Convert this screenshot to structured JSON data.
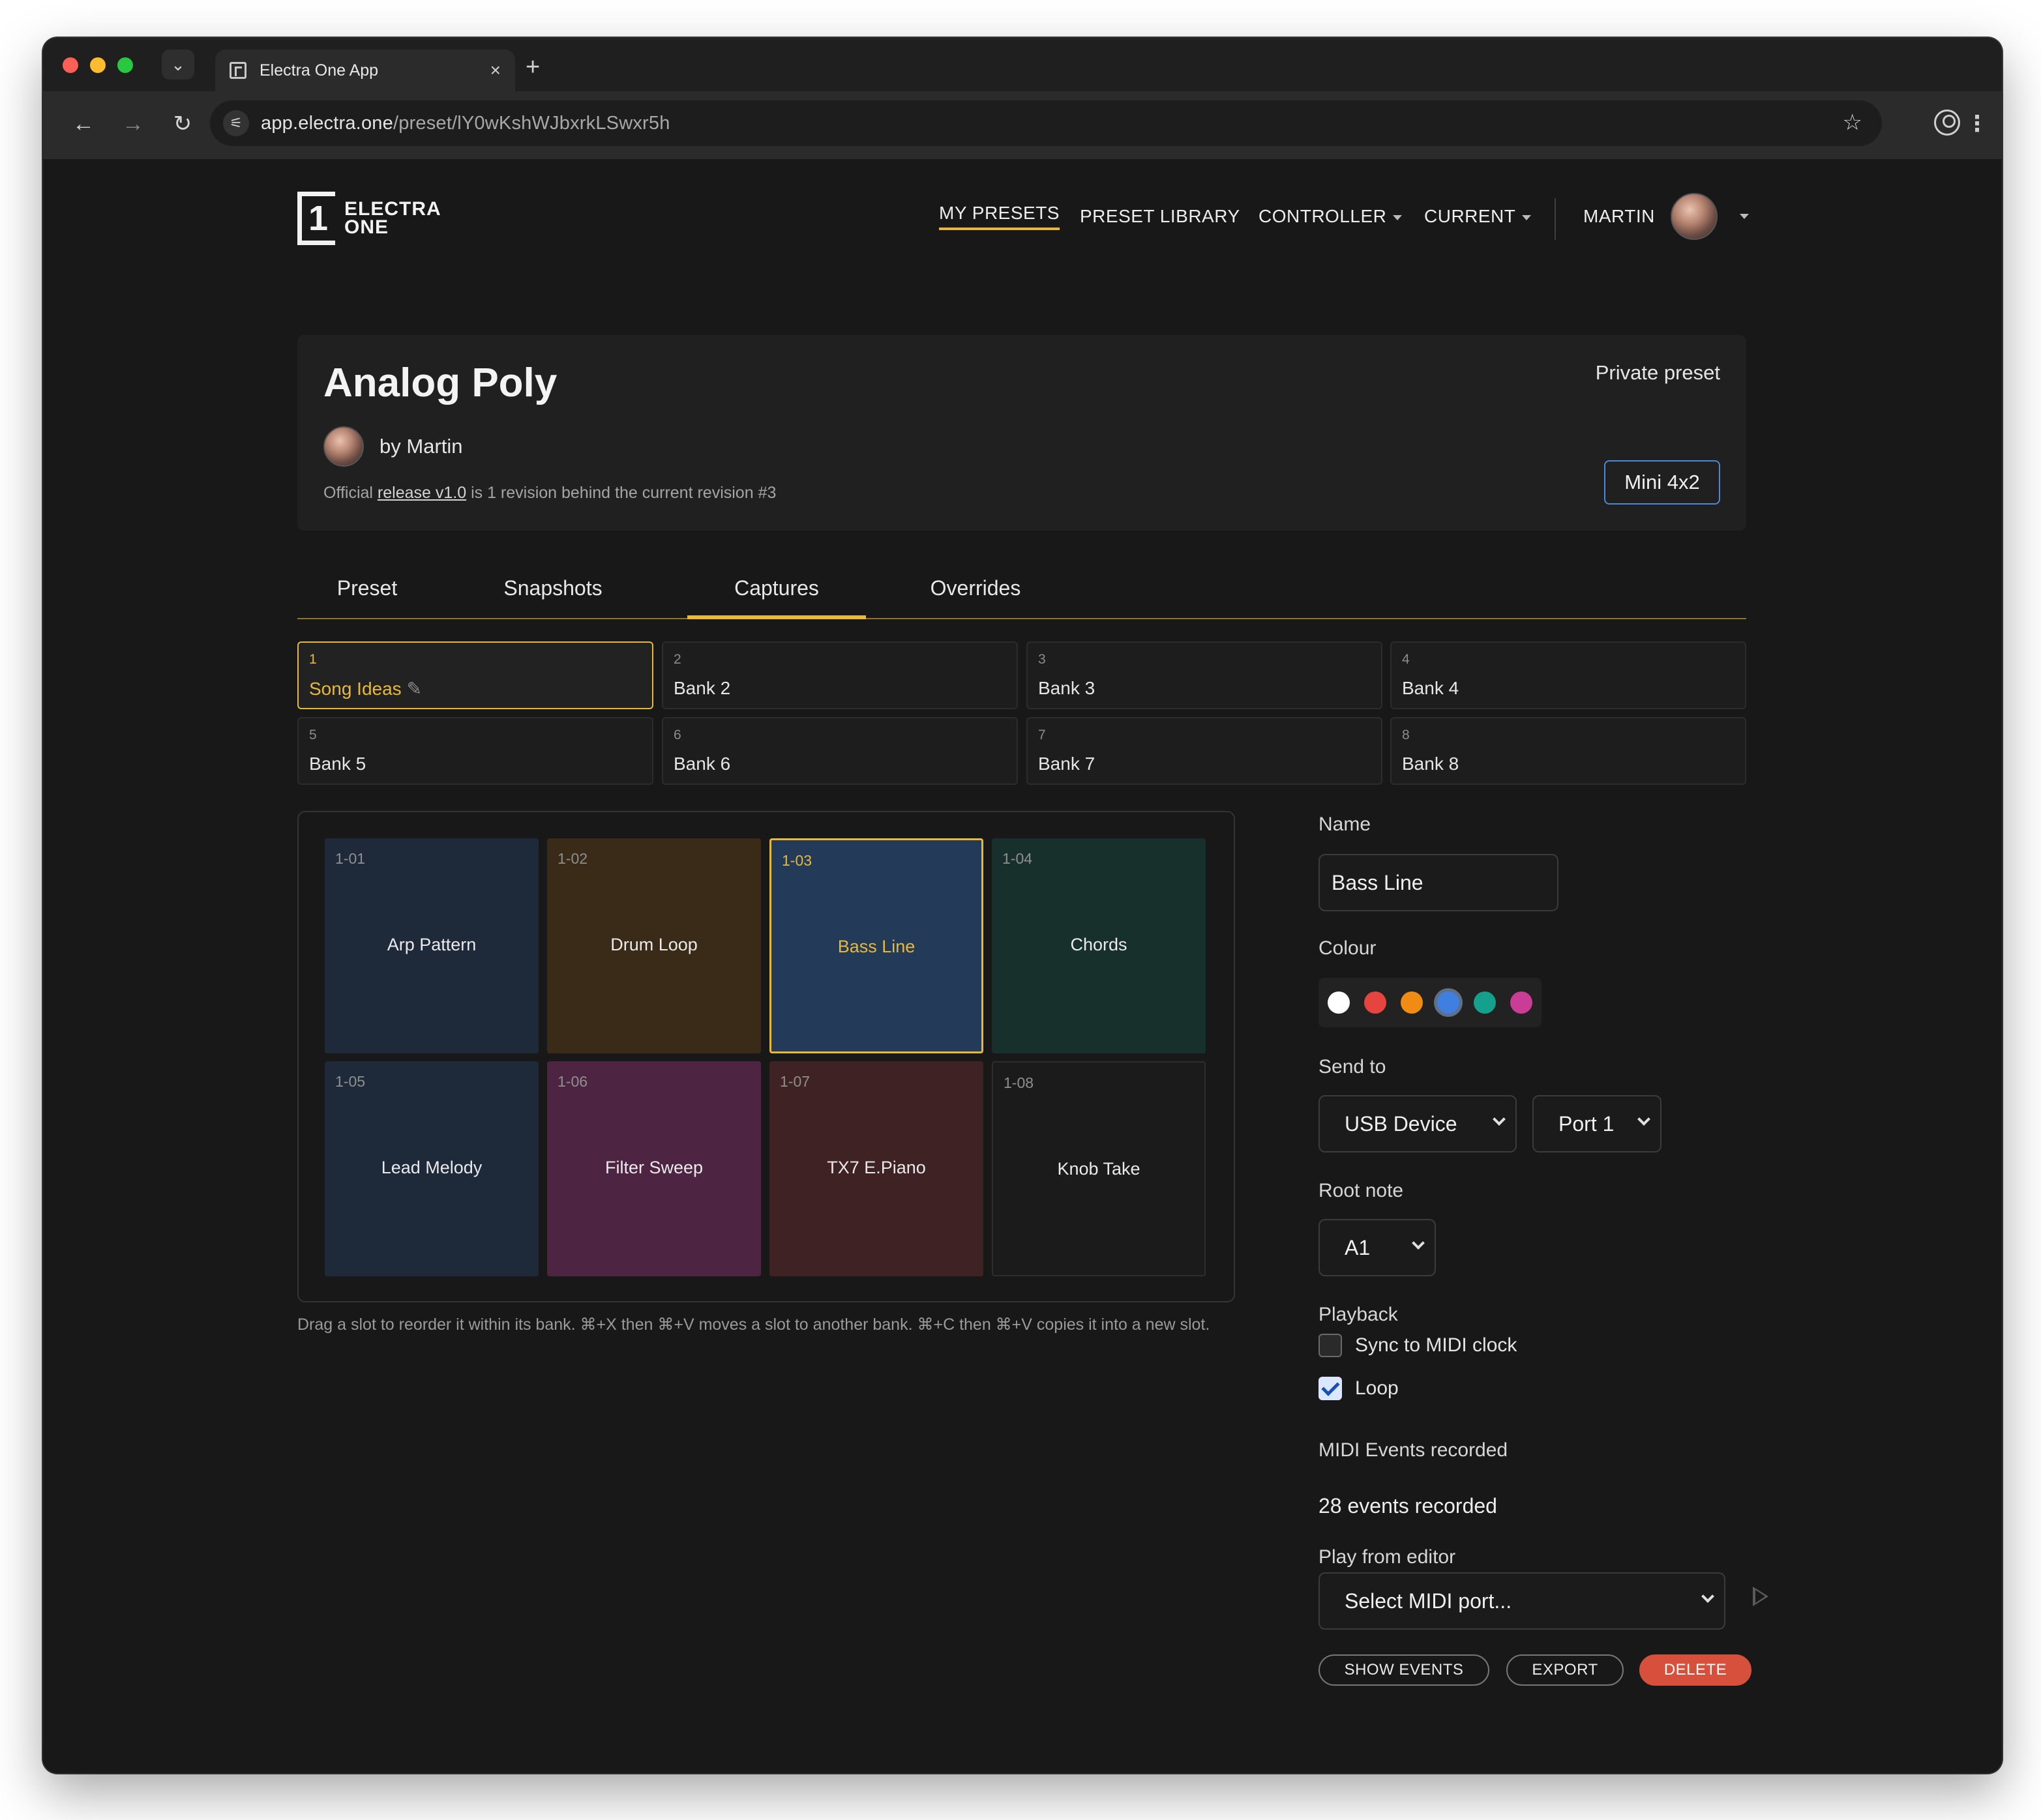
{
  "browser": {
    "tab_title": "Electra One App",
    "url_host": "app.electra.one",
    "url_path": "/preset/lY0wKshWJbxrkLSwxr5h"
  },
  "nav": {
    "logo_line1": "ELECTRA",
    "logo_line2": "ONE",
    "links": [
      "MY PRESETS",
      "PRESET LIBRARY",
      "CONTROLLER",
      "CURRENT"
    ],
    "user": "MARTIN"
  },
  "preset": {
    "title": "Analog Poly",
    "author": "by Martin",
    "release_prefix": "Official",
    "release_link": "release v1.0",
    "release_suffix": "is 1 revision behind the current revision #3",
    "visibility": "Private preset",
    "device": "Mini 4x2"
  },
  "tabs": [
    "Preset",
    "Snapshots",
    "Captures",
    "Overrides"
  ],
  "active_tab": "Captures",
  "banks": [
    {
      "num": "1",
      "label": "Song Ideas"
    },
    {
      "num": "2",
      "label": "Bank 2"
    },
    {
      "num": "3",
      "label": "Bank 3"
    },
    {
      "num": "4",
      "label": "Bank 4"
    },
    {
      "num": "5",
      "label": "Bank 5"
    },
    {
      "num": "6",
      "label": "Bank 6"
    },
    {
      "num": "7",
      "label": "Bank 7"
    },
    {
      "num": "8",
      "label": "Bank 8"
    }
  ],
  "slots": [
    {
      "id": "1-01",
      "name": "Arp Pattern",
      "color": "#1e2a3a"
    },
    {
      "id": "1-02",
      "name": "Drum Loop",
      "color": "#3a2a18"
    },
    {
      "id": "1-03",
      "name": "Bass Line",
      "color": "#233a58"
    },
    {
      "id": "1-04",
      "name": "Chords",
      "color": "#17302c"
    },
    {
      "id": "1-05",
      "name": "Lead Melody",
      "color": "#1e2a3a"
    },
    {
      "id": "1-06",
      "name": "Filter Sweep",
      "color": "#4e2443"
    },
    {
      "id": "1-07",
      "name": "TX7 E.Piano",
      "color": "#3e2224"
    },
    {
      "id": "1-08",
      "name": "Knob Take",
      "color": "#1b1b1b"
    }
  ],
  "hint": "Drag a slot to reorder it within its bank. ⌘+X then ⌘+V moves a slot to another bank. ⌘+C then ⌘+V copies it into a new slot.",
  "form": {
    "name_label": "Name",
    "name_value": "Bass Line",
    "colour_label": "Colour",
    "colours": [
      "#ffffff",
      "#e5443f",
      "#f08c14",
      "#3f7fe0",
      "#14a08c",
      "#c93d96"
    ],
    "selected_colour": "#3f7fe0",
    "send_to_label": "Send to",
    "send_device": "USB Device",
    "send_port": "Port 1",
    "root_note_label": "Root note",
    "root_note": "A1",
    "playback_label": "Playback",
    "sync_label": "Sync to MIDI clock",
    "loop_label": "Loop",
    "sync_checked": false,
    "loop_checked": true,
    "events_label": "MIDI Events recorded",
    "events_value": "28 events recorded",
    "play_label": "Play from editor",
    "play_port": "Select MIDI port...",
    "show_events": "SHOW EVENTS",
    "export": "EXPORT",
    "delete": "DELETE"
  }
}
